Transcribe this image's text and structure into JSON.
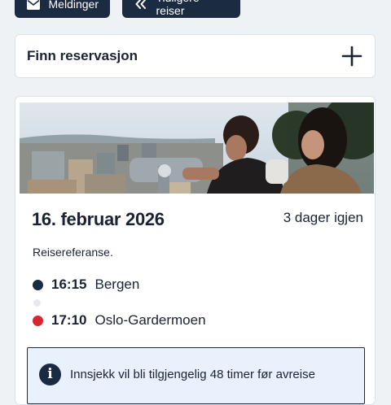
{
  "toolbar": {
    "messages_label": "Meldinger",
    "messages_icon": "envelope-icon",
    "previous_trips_label": "Tidligere reiser",
    "previous_trips_icon": "double-chevron-left-icon"
  },
  "find_reservation": {
    "label": "Finn reservasjon",
    "icon": "plus-icon"
  },
  "trip": {
    "date": "16. februar 2026",
    "days_left": "3 dager igjen",
    "reference_label": "Reisereferanse.",
    "departure": {
      "time": "16:15",
      "place": "Bergen",
      "dot_color": "#1b2b42"
    },
    "arrival": {
      "time": "17:10",
      "place": "Oslo-Gardermoen",
      "dot_color": "#d7262e"
    },
    "info": {
      "icon": "info-icon",
      "text": "Innsjekk vil bli tilgjengelig 48 timer før avreise"
    }
  },
  "colors": {
    "navy": "#1b2b42",
    "background": "#eef2f5",
    "info_background": "#e9f2fc",
    "arrival_red": "#d7262e"
  }
}
